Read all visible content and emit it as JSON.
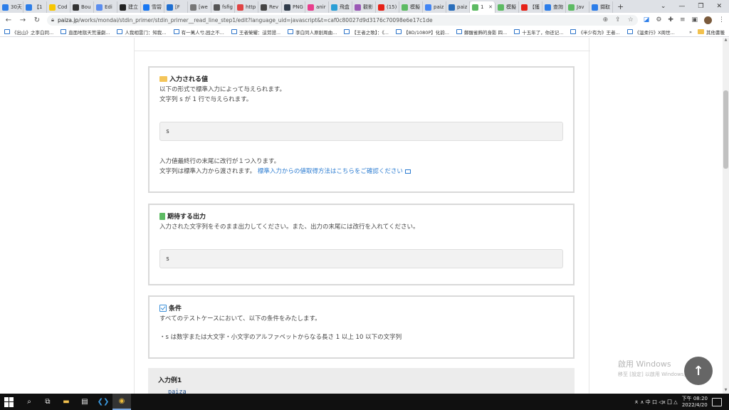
{
  "browser": {
    "tabs": [
      {
        "label": "30天",
        "color": "#2b7de9"
      },
      {
        "label": "【1",
        "color": "#2b7de9"
      },
      {
        "label": "Cod",
        "color": "#f7c600"
      },
      {
        "label": "Bou",
        "color": "#333333"
      },
      {
        "label": "Edi",
        "color": "#5b8def"
      },
      {
        "label": "建立",
        "color": "#222222"
      },
      {
        "label": "雪碧",
        "color": "#1877f2"
      },
      {
        "label": "[F",
        "color": "#1f6fd1"
      },
      {
        "label": "[we",
        "color": "#777777"
      },
      {
        "label": "fsfig",
        "color": "#555555"
      },
      {
        "label": "http",
        "color": "#e04444"
      },
      {
        "label": "Rev",
        "color": "#444444"
      },
      {
        "label": "PNG",
        "color": "#2f3b4a"
      },
      {
        "label": "anir",
        "color": "#e83e8c"
      },
      {
        "label": "飛盒",
        "color": "#2a9fd6"
      },
      {
        "label": "觀影",
        "color": "#9b59b6"
      },
      {
        "label": "(15)",
        "color": "#e62117"
      },
      {
        "label": "模擬",
        "color": "#5dbb63"
      },
      {
        "label": "paiz",
        "color": "#4285f4"
      },
      {
        "label": "paiz",
        "color": "#2a6ebb"
      },
      {
        "label": "1",
        "color": "#5dbb63"
      },
      {
        "label": "模擬",
        "color": "#5dbb63"
      },
      {
        "label": "【獲",
        "color": "#e62117"
      },
      {
        "label": "查詢",
        "color": "#2b7de9"
      },
      {
        "label": "Jav",
        "color": "#5dbb63"
      },
      {
        "label": "擷取",
        "color": "#2b7de9"
      }
    ],
    "new_tab": "+",
    "url_host": "paiza.jp",
    "url_path": "/works/mondai/stdin_primer/stdin_primer__read_line_step1/edit?language_uid=javascript&t=caf0c80027d9d3176c70098e6e17c1de",
    "bookmarks": [
      "《出山》之李白同...",
      "直面地獄天荒漫劇...",
      "人我相雲门：知我...",
      "有一萬人兮,园之不...",
      "王者榮耀：這劳證...",
      "李白同人原創周曲...",
      "【王者之歌】：《...",
      "【8D/1080P】化韵...",
      "鄭醒雀飾的身影 四...",
      "十五年了，你还记...",
      "《半少有为》王者...",
      "《溫柔行》X周世..."
    ],
    "bookmarks_more": "»",
    "other_bookmarks": "其他書籤"
  },
  "page": {
    "input_section": {
      "title": "入力される値",
      "line1": "以下の形式で標準入力によって与えられます。",
      "line2": "文字列 s が 1 行で与えられます。",
      "code": "s",
      "note1": "入力値最終行の末尾に改行が１つ入ります。",
      "note2": "文字列は標準入力から渡されます。",
      "link": "標準入力からの値取得方法はこちらをご確認ください"
    },
    "output_section": {
      "title": "期待する出力",
      "line1": "入力された文字列をそのまま出力してください。また、出力の末尾には改行を入れてください。",
      "code": "s"
    },
    "condition_section": {
      "title": "条件",
      "line1": "すべてのテストケースにおいて、以下の条件をみたします。",
      "line2": "・s は数字または大文字・小文字のアルファベットからなる長さ 1 以上 10 以下の文字列"
    },
    "example": {
      "title": "入力例1",
      "code": "paiza"
    }
  },
  "watermark": {
    "line1": "啟用 Windows",
    "line2": "移至 [設定] 以啟用 Windows。"
  },
  "taskbar": {
    "time": "下午 08:20",
    "date": "2022/4/20",
    "tray": "ㅊ ∧ 中 口 ◁ⅹ 囗 △"
  }
}
